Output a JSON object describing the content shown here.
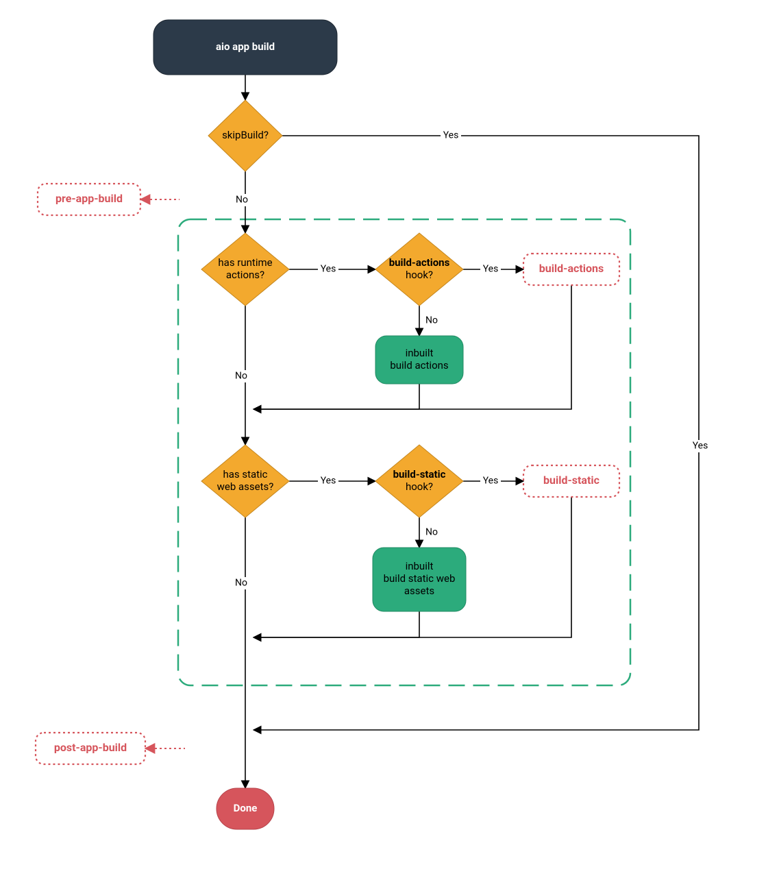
{
  "colors": {
    "start_fill": "#2c3a49",
    "diamond_fill": "#f3a92e",
    "process_fill": "#2cab7c",
    "done_fill": "#d6555c",
    "hook_stroke": "#d6555c",
    "extension_stroke": "#2cab7c",
    "edge": "#000000"
  },
  "nodes": {
    "start": {
      "label": "aio app build"
    },
    "skipBuild": {
      "label": "skipBuild?"
    },
    "preAppBuild": {
      "label": "pre-app-build"
    },
    "hasRuntime": {
      "line1": "has runtime",
      "line2": "actions?"
    },
    "buildActionsHook": {
      "line1_bold": "build-actions",
      "line2": "hook?"
    },
    "buildActionsCustom": {
      "label": "build-actions"
    },
    "inbuiltActions": {
      "line1": "inbuilt",
      "line2": "build actions"
    },
    "hasStatic": {
      "line1": "has static",
      "line2": "web assets?"
    },
    "buildStaticHook": {
      "line1_bold": "build-static",
      "line2": "hook?"
    },
    "buildStaticCustom": {
      "label": "build-static"
    },
    "inbuiltStatic": {
      "line1": "inbuilt",
      "line2": "build static web",
      "line3": "assets"
    },
    "postAppBuild": {
      "label": "post-app-build"
    },
    "done": {
      "label": "Done"
    }
  },
  "edges": {
    "yes": "Yes",
    "no": "No"
  }
}
